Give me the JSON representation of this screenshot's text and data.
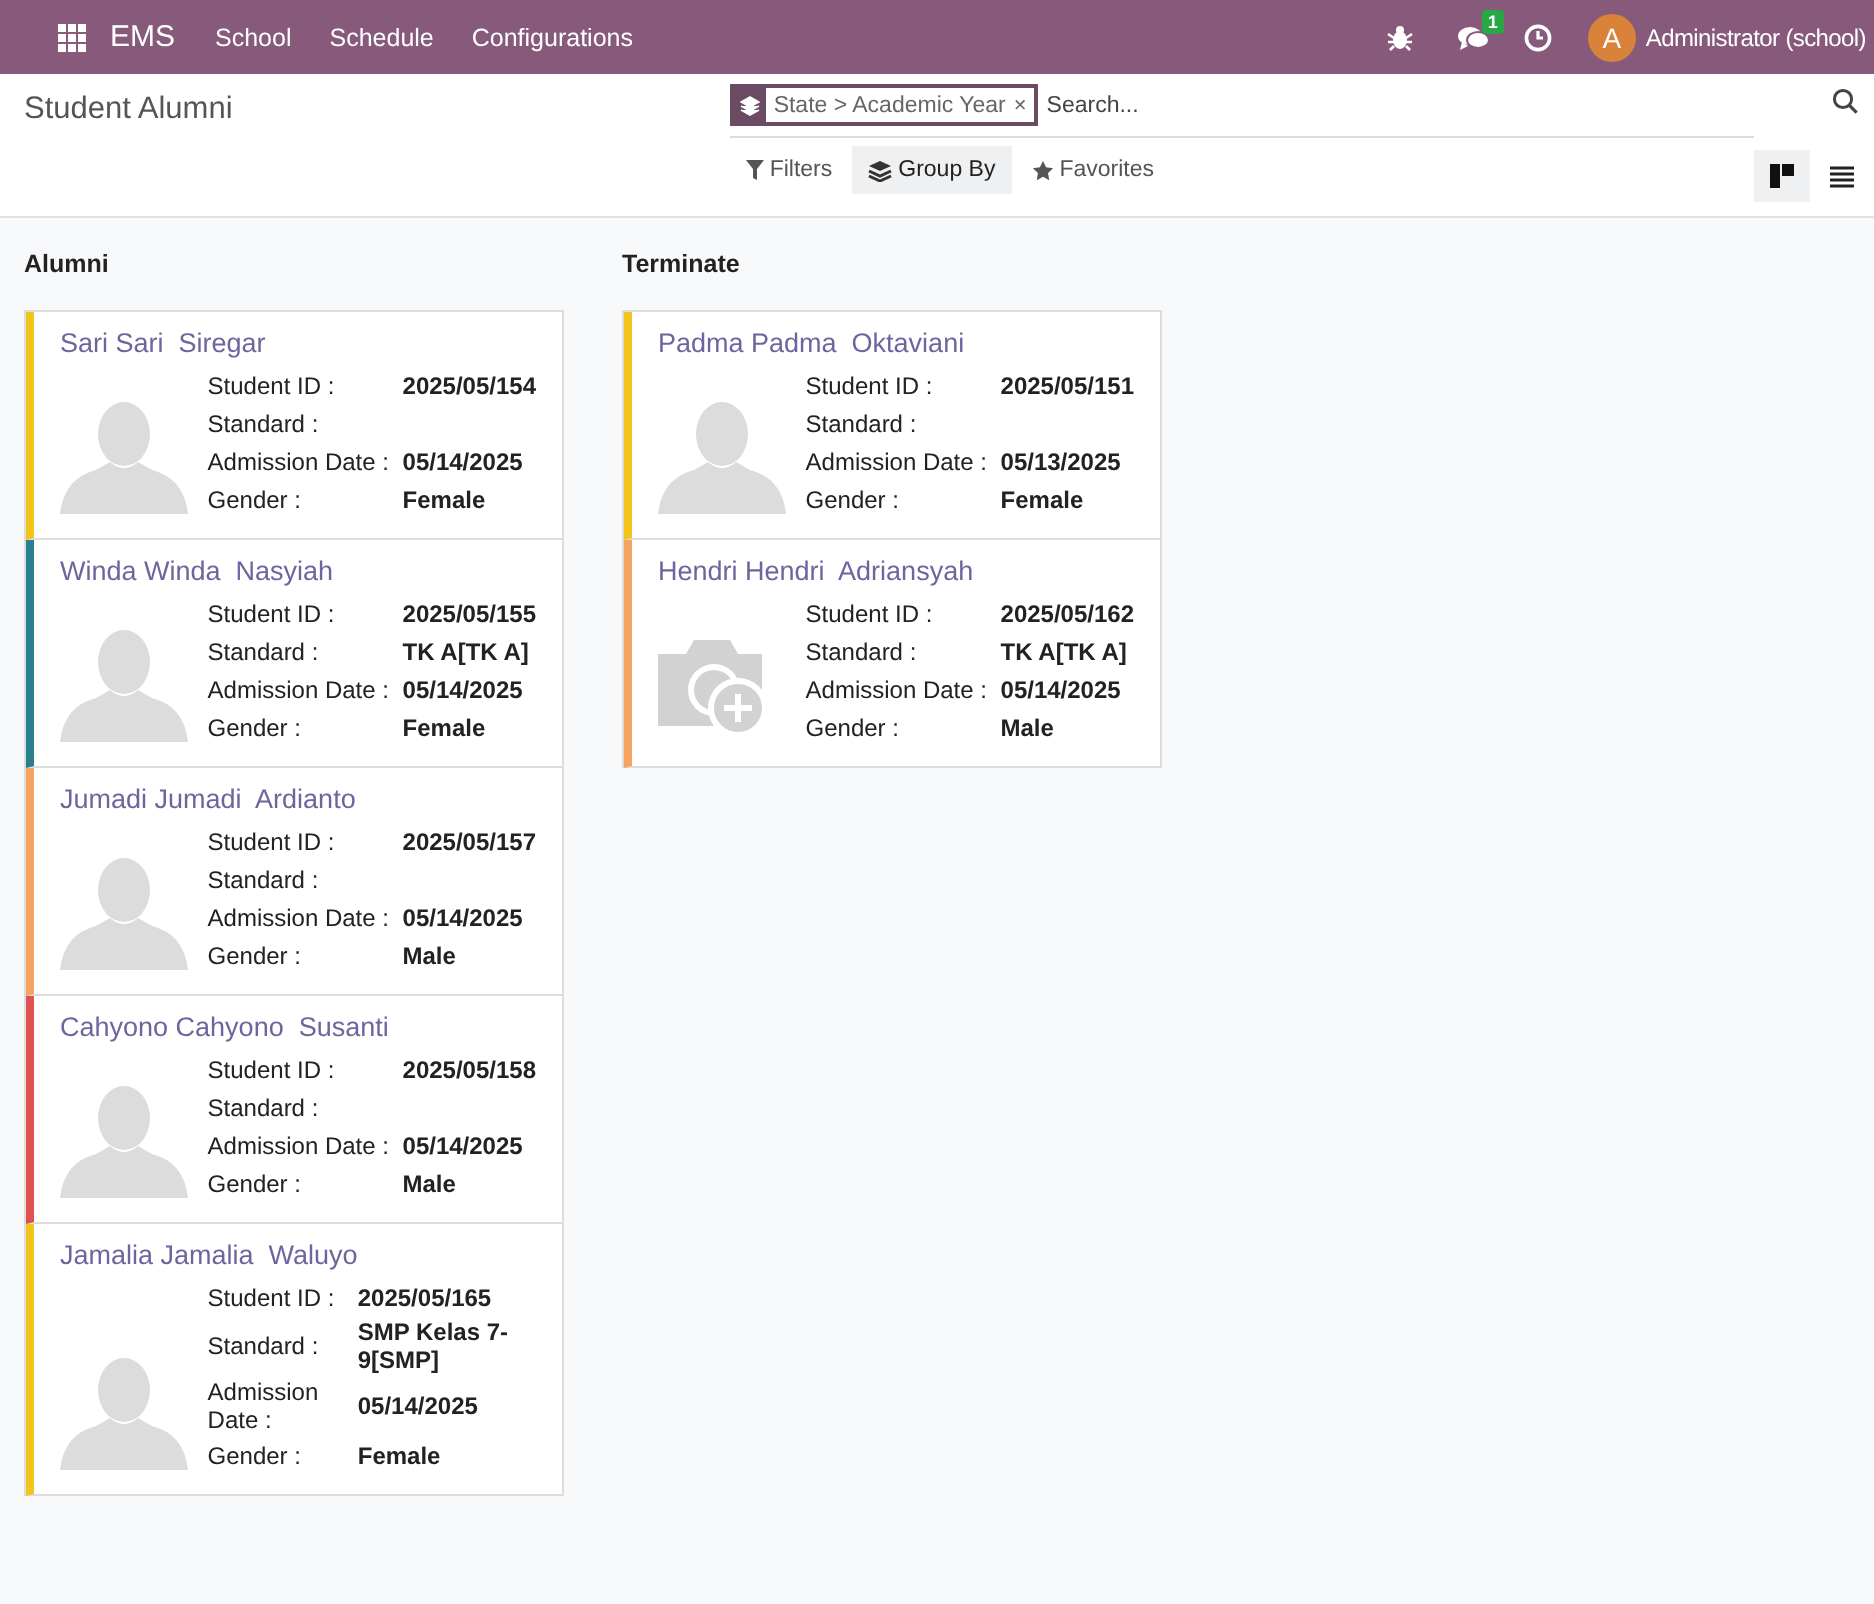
{
  "navbar": {
    "app_name": "EMS",
    "menu": [
      "School",
      "Schedule",
      "Configurations"
    ],
    "messages_badge": "1",
    "avatar_letter": "A",
    "user": "Administrator (school)"
  },
  "control_panel": {
    "title": "Student Alumni",
    "facet": "State > Academic Year",
    "facet_remove": "×",
    "search": {
      "placeholder": "Search..."
    },
    "buttons": [
      {
        "label": "Filters",
        "kind": "filter",
        "selected": false
      },
      {
        "label": "Group By",
        "kind": "group",
        "selected": true
      },
      {
        "label": "Favorites",
        "kind": "star",
        "selected": false
      }
    ],
    "views": [
      {
        "kind": "kanban",
        "selected": true
      },
      {
        "kind": "list",
        "selected": false
      }
    ]
  },
  "columns": [
    {
      "title": "Alumni",
      "cards": [
        {
          "name": "Sari Sari  Siregar",
          "color": "#f3c41a",
          "kind": "person",
          "fields": [
            {
              "label": "Student ID :",
              "value": "2025/05/154"
            },
            {
              "label": "Standard :"
            },
            {
              "label": "Admission Date :",
              "value": "05/14/2025"
            },
            {
              "label": "Gender :",
              "value": "Female"
            }
          ]
        },
        {
          "name": "Winda Winda  Nasyiah",
          "color": "#2a7f8f",
          "kind": "person",
          "fields": [
            {
              "label": "Student ID :",
              "value": "2025/05/155"
            },
            {
              "label": "Standard :",
              "value": "TK A[TK A]"
            },
            {
              "label": "Admission Date :",
              "value": "05/14/2025"
            },
            {
              "label": "Gender :",
              "value": "Female"
            }
          ]
        },
        {
          "name": "Jumadi Jumadi  Ardianto",
          "color": "#f4a460",
          "kind": "person",
          "fields": [
            {
              "label": "Student ID :",
              "value": "2025/05/157"
            },
            {
              "label": "Standard :"
            },
            {
              "label": "Admission Date :",
              "value": "05/14/2025"
            },
            {
              "label": "Gender :",
              "value": "Male"
            }
          ]
        },
        {
          "name": "Cahyono Cahyono  Susanti",
          "color": "#e05252",
          "kind": "person",
          "fields": [
            {
              "label": "Student ID :",
              "value": "2025/05/158"
            },
            {
              "label": "Standard :"
            },
            {
              "label": "Admission Date :",
              "value": "05/14/2025"
            },
            {
              "label": "Gender :",
              "value": "Male"
            }
          ]
        },
        {
          "name": "Jamalia Jamalia  Waluyo",
          "color": "#f3c41a",
          "kind": "person",
          "fields": [
            {
              "label": "Student ID :",
              "value": "2025/05/165"
            },
            {
              "label": "Standard :",
              "value": "SMP Kelas 7-9[SMP]"
            },
            {
              "label": "Admission Date :",
              "value": "05/14/2025"
            },
            {
              "label": "Gender :",
              "value": "Female"
            }
          ]
        }
      ]
    },
    {
      "title": "Terminate",
      "cards": [
        {
          "name": "Padma Padma  Oktaviani",
          "color": "#f3c41a",
          "kind": "person",
          "fields": [
            {
              "label": "Student ID :",
              "value": "2025/05/151"
            },
            {
              "label": "Standard :"
            },
            {
              "label": "Admission Date :",
              "value": "05/13/2025"
            },
            {
              "label": "Gender :",
              "value": "Female"
            }
          ]
        },
        {
          "name": "Hendri Hendri  Adriansyah",
          "color": "#f4a460",
          "kind": "camera",
          "fields": [
            {
              "label": "Student ID :",
              "value": "2025/05/162"
            },
            {
              "label": "Standard :",
              "value": "TK A[TK A]"
            },
            {
              "label": "Admission Date :",
              "value": "05/14/2025"
            },
            {
              "label": "Gender :",
              "value": "Male"
            }
          ]
        }
      ]
    }
  ]
}
